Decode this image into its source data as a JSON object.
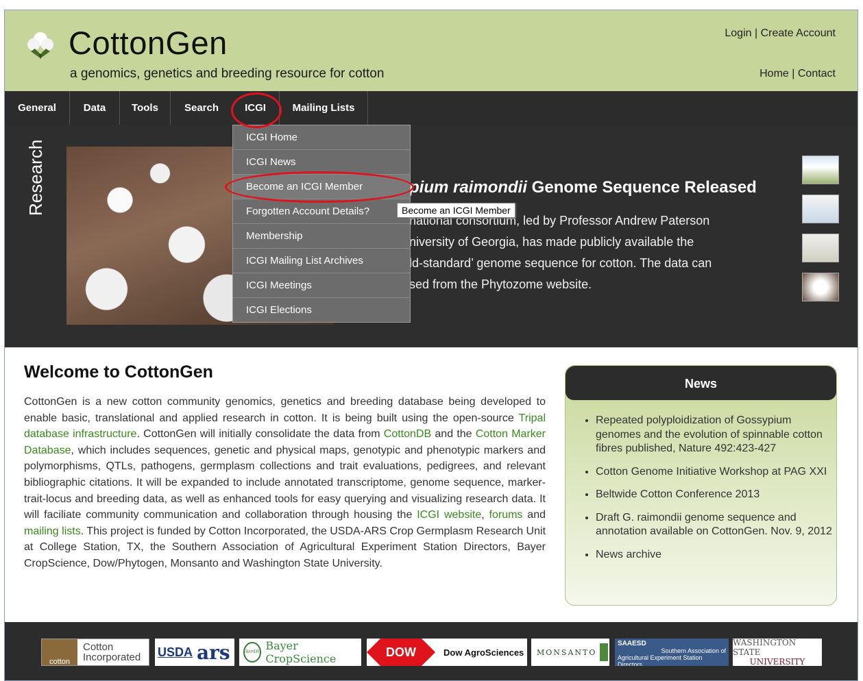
{
  "header": {
    "title": "CottonGen",
    "tagline": "a genomics, genetics and breeding resource for cotton",
    "login": "Login",
    "create_account": "Create Account",
    "home": "Home",
    "contact": "Contact",
    "separator": "|"
  },
  "nav": {
    "items": [
      {
        "label": "General"
      },
      {
        "label": "Data"
      },
      {
        "label": "Tools"
      },
      {
        "label": "Search"
      },
      {
        "label": "ICGI"
      },
      {
        "label": "Mailing Lists"
      }
    ]
  },
  "dropdown": {
    "items": [
      {
        "label": "ICGI Home"
      },
      {
        "label": "ICGI News"
      },
      {
        "label": "Become an ICGI Member"
      },
      {
        "label": "Forgotten Account Details?"
      },
      {
        "label": "Membership"
      },
      {
        "label": "ICGI Mailing List Archives"
      },
      {
        "label": "ICGI Meetings"
      },
      {
        "label": "ICGI Elections"
      }
    ],
    "tooltip": "Become an ICGI Member"
  },
  "hero": {
    "side_label": "Research",
    "headline_italic": "pium raimondii",
    "headline_rest": " Genome Sequence Released",
    "lines": [
      "national consortium, led by Professor Andrew Paterson",
      "niversity of Georgia, has made publicly available the",
      "ld-standard’ genome sequence for cotton. The data can",
      "sed from the Phytozome website."
    ]
  },
  "welcome": {
    "title": "Welcome to CottonGen",
    "p1": "CottonGen is a new cotton community genomics, genetics and breeding database being developed to enable basic, translational and applied research in cotton.  It is being built using the open-source ",
    "link_tripal": "Tripal database infrastructure",
    "p2": ".  CottonGen will initially consolidate the data from ",
    "link_cottondb": "CottonDB",
    "p3": " and the ",
    "link_cmd": "Cotton Marker Database",
    "p4": ", which includes sequences, genetic and physical maps, genotypic and phenotypic markers and polymorphisms, QTLs, pathogens, germplasm collections and trait evaluations, pedigrees, and relevant bibliographic citations.  It will be expanded to include annotated transcriptome, genome sequence, marker-trait-locus and breeding data, as well as enhanced tools for easy querying and visualizing research data. It will faciliate community communication and collaboration through housing the ",
    "link_icgi": "ICGI website",
    "p5": ", ",
    "link_forums": "forums",
    "p6": " and ",
    "link_mailing": "mailing lists",
    "p7": ". This project is funded by Cotton Incorporated, the USDA-ARS Crop Germplasm Research Unit at College Station, TX, the Southern Association of Agricultural Experiment Station Directors, Bayer CropScience, Dow/Phytogen, Monsanto and Washington State University."
  },
  "news": {
    "title": "News",
    "items": [
      {
        "label": "Repeated polyploidization of Gossypium genomes and the evolution of spinnable cotton fibres published, Nature 492:423-427"
      },
      {
        "label": "Cotton Genome Initiative Workshop at PAG XXI"
      },
      {
        "label": "Beltwide Cotton Conference 2013"
      },
      {
        "label": "Draft G. raimondii genome sequence and annotation available on CottonGen. Nov. 9, 2012"
      },
      {
        "label": "News archive"
      }
    ]
  },
  "footer": {
    "cotton_inc_a": "Cotton",
    "cotton_inc_b": "Incorporated",
    "cotton_inc_badge": "cotton",
    "usda": "USDA",
    "ars": "ars",
    "bayer_badge": "BAYER",
    "bayer": "Bayer CropScience",
    "dow": "DOW",
    "dow_agro": "Dow AgroSciences",
    "monsanto": "MONSANTO",
    "saaesd_badge": "SAAESD",
    "saaesd_a": "Southern Association of",
    "saaesd_b": "Agricultural Experiment Station Directors",
    "wsu_a": "WASHINGTON STATE",
    "wsu_b": "UNIVERSITY"
  },
  "colors": {
    "header_bg": "#c6d69a",
    "nav_bg": "#2c2c2c",
    "link_green": "#3a8a1e",
    "highlight_red": "#e0121b"
  }
}
